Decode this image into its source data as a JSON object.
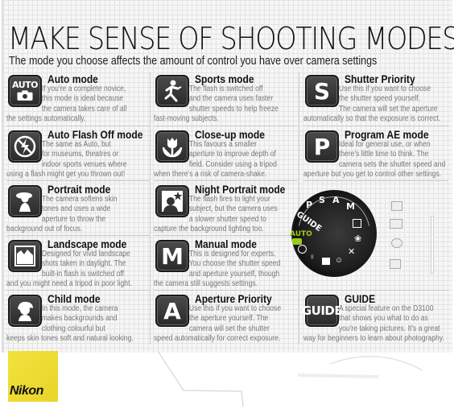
{
  "header": {
    "title": "MAKE SENSE OF SHOOTING MODES",
    "subtitle": "The mode you choose affects the amount of control you have over camera settings"
  },
  "columns": [
    {
      "modes": [
        {
          "icon": "auto-camera-icon",
          "tile_text": "AUTO",
          "title": "Auto mode",
          "lines": [
            "If you're a complete novice,",
            "this mode is ideal because",
            "the camera takes care of all",
            "the settings automatically."
          ]
        },
        {
          "icon": "flash-off-icon",
          "title": "Auto Flash Off mode",
          "lines": [
            "The same as Auto, but",
            "for museums, theatres or",
            "indoor sports venues where",
            "using a flash might get you thrown out!"
          ]
        },
        {
          "icon": "portrait-icon",
          "title": "Portrait mode",
          "lines": [
            "The camera softens skin",
            "tones and uses a wide",
            "aperture to throw the",
            "background out of focus."
          ]
        },
        {
          "icon": "landscape-icon",
          "title": "Landscape mode",
          "lines": [
            "Designed for vivid landscape",
            "shots taken in daylight. The",
            "built-in flash is switched off",
            "and you might need a tripod in poor light."
          ]
        },
        {
          "icon": "child-icon",
          "title": "Child mode",
          "lines": [
            "In this mode, the camera",
            "makes backgrounds and",
            "clothing colourful but",
            "keeps skin tones soft and natural looking."
          ]
        }
      ]
    },
    {
      "modes": [
        {
          "icon": "sports-runner-icon",
          "title": "Sports mode",
          "lines": [
            "The flash is switched off",
            "and the camera uses faster",
            "shutter speeds to help freeze",
            "fast-moving subjects."
          ]
        },
        {
          "icon": "close-up-flower-icon",
          "title": "Close-up mode",
          "lines": [
            "This favours a smaller",
            "aperture to improve depth of",
            "field. Consider using a tripod",
            "when there's a risk of camera-shake."
          ]
        },
        {
          "icon": "night-portrait-icon",
          "title": "Night Portrait mode",
          "lines": [
            "The flash fires to light your",
            "subject, but the camera uses",
            "a slower shutter speed to",
            "capture the background lighting too."
          ]
        },
        {
          "icon": "manual-icon",
          "tile_text": "M",
          "title": "Manual mode",
          "lines": [
            "This is designed for experts.",
            "You choose the shutter speed",
            "and aperture yourself, though",
            "the camera still suggests settings."
          ]
        },
        {
          "icon": "aperture-priority-icon",
          "tile_text": "A",
          "title": "Aperture Priority",
          "lines": [
            "Use this if you want to choose",
            "the aperture yourself. The",
            "camera will set the shutter",
            "speed automatically for correct exposure."
          ]
        }
      ]
    },
    {
      "modes": [
        {
          "icon": "shutter-priority-icon",
          "tile_text": "S",
          "title": "Shutter Priority",
          "lines": [
            "Use this if you want to choose",
            "the shutter speed yourself.",
            "The camera will set the aperture",
            "automatically so that the exposure is correct."
          ]
        },
        {
          "icon": "program-ae-icon",
          "tile_text": "P",
          "title": "Program AE mode",
          "lines": [
            "Ideal for general use, or when",
            "there's little time to think. The",
            "camera sets the shutter speed and",
            "aperture but you get to control other settings."
          ]
        },
        {
          "spacer": true
        },
        {
          "spacer": true
        },
        {
          "icon": "guide-icon",
          "tile_text": "GUIDE",
          "title": "GUIDE",
          "lines": [
            "A special feature on the D3100",
            "that shows you what to do as",
            "you're taking pictures. It's a great",
            "way for beginners to learn about photography."
          ]
        }
      ]
    }
  ],
  "dial": {
    "labels": [
      "P",
      "S",
      "A",
      "M",
      "GUIDE",
      "AUTO"
    ],
    "accent": "#9ccc1a"
  },
  "brand": {
    "name": "Nikon",
    "color": "#f0df36"
  }
}
